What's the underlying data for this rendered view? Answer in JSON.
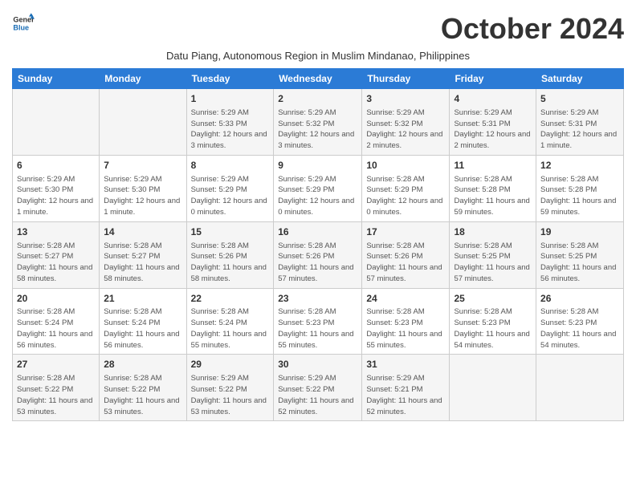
{
  "logo": {
    "line1": "General",
    "line2": "Blue"
  },
  "title": "October 2024",
  "subtitle": "Datu Piang, Autonomous Region in Muslim Mindanao, Philippines",
  "days_header": [
    "Sunday",
    "Monday",
    "Tuesday",
    "Wednesday",
    "Thursday",
    "Friday",
    "Saturday"
  ],
  "weeks": [
    [
      {
        "day": "",
        "info": ""
      },
      {
        "day": "",
        "info": ""
      },
      {
        "day": "1",
        "info": "Sunrise: 5:29 AM\nSunset: 5:33 PM\nDaylight: 12 hours and 3 minutes."
      },
      {
        "day": "2",
        "info": "Sunrise: 5:29 AM\nSunset: 5:32 PM\nDaylight: 12 hours and 3 minutes."
      },
      {
        "day": "3",
        "info": "Sunrise: 5:29 AM\nSunset: 5:32 PM\nDaylight: 12 hours and 2 minutes."
      },
      {
        "day": "4",
        "info": "Sunrise: 5:29 AM\nSunset: 5:31 PM\nDaylight: 12 hours and 2 minutes."
      },
      {
        "day": "5",
        "info": "Sunrise: 5:29 AM\nSunset: 5:31 PM\nDaylight: 12 hours and 1 minute."
      }
    ],
    [
      {
        "day": "6",
        "info": "Sunrise: 5:29 AM\nSunset: 5:30 PM\nDaylight: 12 hours and 1 minute."
      },
      {
        "day": "7",
        "info": "Sunrise: 5:29 AM\nSunset: 5:30 PM\nDaylight: 12 hours and 1 minute."
      },
      {
        "day": "8",
        "info": "Sunrise: 5:29 AM\nSunset: 5:29 PM\nDaylight: 12 hours and 0 minutes."
      },
      {
        "day": "9",
        "info": "Sunrise: 5:29 AM\nSunset: 5:29 PM\nDaylight: 12 hours and 0 minutes."
      },
      {
        "day": "10",
        "info": "Sunrise: 5:28 AM\nSunset: 5:29 PM\nDaylight: 12 hours and 0 minutes."
      },
      {
        "day": "11",
        "info": "Sunrise: 5:28 AM\nSunset: 5:28 PM\nDaylight: 11 hours and 59 minutes."
      },
      {
        "day": "12",
        "info": "Sunrise: 5:28 AM\nSunset: 5:28 PM\nDaylight: 11 hours and 59 minutes."
      }
    ],
    [
      {
        "day": "13",
        "info": "Sunrise: 5:28 AM\nSunset: 5:27 PM\nDaylight: 11 hours and 58 minutes."
      },
      {
        "day": "14",
        "info": "Sunrise: 5:28 AM\nSunset: 5:27 PM\nDaylight: 11 hours and 58 minutes."
      },
      {
        "day": "15",
        "info": "Sunrise: 5:28 AM\nSunset: 5:26 PM\nDaylight: 11 hours and 58 minutes."
      },
      {
        "day": "16",
        "info": "Sunrise: 5:28 AM\nSunset: 5:26 PM\nDaylight: 11 hours and 57 minutes."
      },
      {
        "day": "17",
        "info": "Sunrise: 5:28 AM\nSunset: 5:26 PM\nDaylight: 11 hours and 57 minutes."
      },
      {
        "day": "18",
        "info": "Sunrise: 5:28 AM\nSunset: 5:25 PM\nDaylight: 11 hours and 57 minutes."
      },
      {
        "day": "19",
        "info": "Sunrise: 5:28 AM\nSunset: 5:25 PM\nDaylight: 11 hours and 56 minutes."
      }
    ],
    [
      {
        "day": "20",
        "info": "Sunrise: 5:28 AM\nSunset: 5:24 PM\nDaylight: 11 hours and 56 minutes."
      },
      {
        "day": "21",
        "info": "Sunrise: 5:28 AM\nSunset: 5:24 PM\nDaylight: 11 hours and 56 minutes."
      },
      {
        "day": "22",
        "info": "Sunrise: 5:28 AM\nSunset: 5:24 PM\nDaylight: 11 hours and 55 minutes."
      },
      {
        "day": "23",
        "info": "Sunrise: 5:28 AM\nSunset: 5:23 PM\nDaylight: 11 hours and 55 minutes."
      },
      {
        "day": "24",
        "info": "Sunrise: 5:28 AM\nSunset: 5:23 PM\nDaylight: 11 hours and 55 minutes."
      },
      {
        "day": "25",
        "info": "Sunrise: 5:28 AM\nSunset: 5:23 PM\nDaylight: 11 hours and 54 minutes."
      },
      {
        "day": "26",
        "info": "Sunrise: 5:28 AM\nSunset: 5:23 PM\nDaylight: 11 hours and 54 minutes."
      }
    ],
    [
      {
        "day": "27",
        "info": "Sunrise: 5:28 AM\nSunset: 5:22 PM\nDaylight: 11 hours and 53 minutes."
      },
      {
        "day": "28",
        "info": "Sunrise: 5:28 AM\nSunset: 5:22 PM\nDaylight: 11 hours and 53 minutes."
      },
      {
        "day": "29",
        "info": "Sunrise: 5:29 AM\nSunset: 5:22 PM\nDaylight: 11 hours and 53 minutes."
      },
      {
        "day": "30",
        "info": "Sunrise: 5:29 AM\nSunset: 5:22 PM\nDaylight: 11 hours and 52 minutes."
      },
      {
        "day": "31",
        "info": "Sunrise: 5:29 AM\nSunset: 5:21 PM\nDaylight: 11 hours and 52 minutes."
      },
      {
        "day": "",
        "info": ""
      },
      {
        "day": "",
        "info": ""
      }
    ]
  ]
}
